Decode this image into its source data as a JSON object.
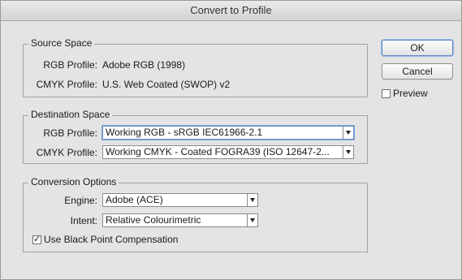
{
  "window": {
    "title": "Convert to Profile"
  },
  "source_space": {
    "legend": "Source Space",
    "rgb_label": "RGB Profile:",
    "rgb_value": "Adobe RGB (1998)",
    "cmyk_label": "CMYK Profile:",
    "cmyk_value": "U.S. Web Coated (SWOP) v2"
  },
  "destination_space": {
    "legend": "Destination Space",
    "rgb_label": "RGB Profile:",
    "rgb_value": "Working RGB - sRGB IEC61966-2.1",
    "cmyk_label": "CMYK Profile:",
    "cmyk_value": "Working CMYK - Coated FOGRA39 (ISO 12647-2..."
  },
  "conversion_options": {
    "legend": "Conversion Options",
    "engine_label": "Engine:",
    "engine_value": "Adobe (ACE)",
    "intent_label": "Intent:",
    "intent_value": "Relative Colourimetric",
    "bpc_label": "Use Black Point Compensation",
    "bpc_checked": true
  },
  "buttons": {
    "ok": "OK",
    "cancel": "Cancel"
  },
  "preview": {
    "label": "Preview",
    "checked": false
  }
}
